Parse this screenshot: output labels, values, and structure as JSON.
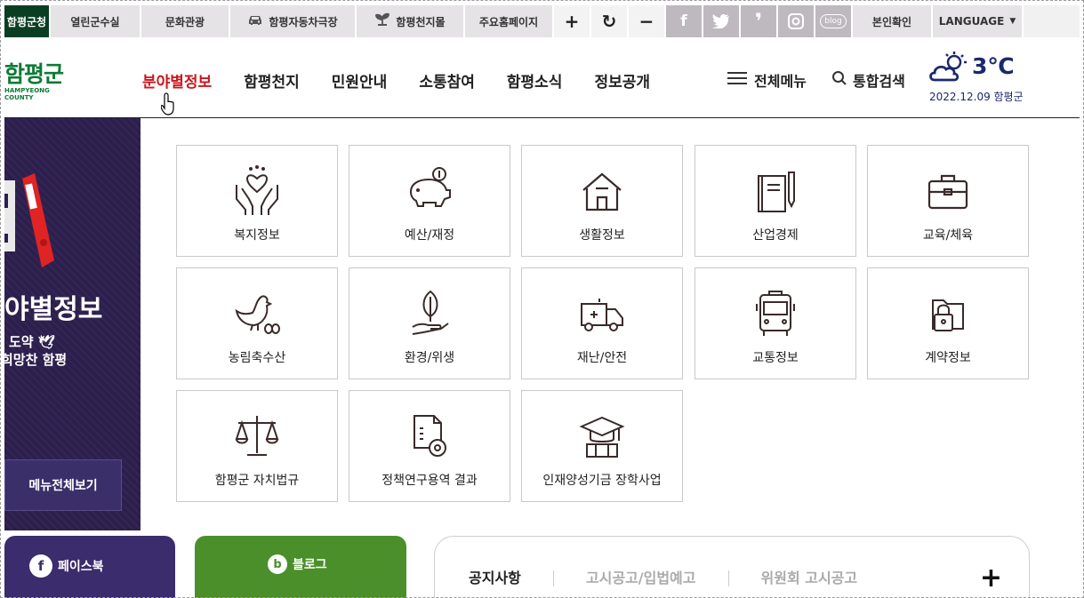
{
  "topbar": {
    "home": "함평군청",
    "items": [
      "열린군수실",
      "문화관광",
      "함평자동차극장",
      "함평천지몰",
      "주요홈페이지"
    ],
    "controls": [
      "+",
      "↻",
      "−"
    ],
    "sns": [
      "f",
      "🐦",
      "❜",
      "◎",
      "blog"
    ],
    "verify": "본인확인",
    "language": "LANGUAGE"
  },
  "header": {
    "logo_name": "함평군",
    "logo_sub": "HAMPYEONG COUNTY",
    "gnb": [
      "분야별정보",
      "함평천지",
      "민원안내",
      "소통참여",
      "함평소식",
      "정보공개"
    ],
    "all_menu": "전체메뉴",
    "search": "통합검색",
    "weather_temp": "3℃",
    "weather_date": "2022.12.09  함평군"
  },
  "left_panel": {
    "title": "야별정보",
    "subtitle_line1": "도약",
    "subtitle_line2": "희망찬 함평",
    "all_menu_button": "메뉴전체보기"
  },
  "cards": [
    {
      "label": "복지정보",
      "icon": "hands-heart-icon"
    },
    {
      "label": "예산/재정",
      "icon": "piggy-bank-icon"
    },
    {
      "label": "생활정보",
      "icon": "house-icon"
    },
    {
      "label": "산업경제",
      "icon": "book-pen-icon"
    },
    {
      "label": "교육/체육",
      "icon": "briefcase-icon"
    },
    {
      "label": "농림축수산",
      "icon": "chicken-icon"
    },
    {
      "label": "환경/위생",
      "icon": "leaf-hand-icon"
    },
    {
      "label": "재난/안전",
      "icon": "ambulance-icon"
    },
    {
      "label": "교통정보",
      "icon": "bus-icon"
    },
    {
      "label": "계약정보",
      "icon": "locked-folder-icon"
    },
    {
      "label": "함평군 자치법규",
      "icon": "scales-icon"
    },
    {
      "label": "정책연구용역 결과",
      "icon": "document-gear-icon"
    },
    {
      "label": "인재양성기금 장학사업",
      "icon": "graduation-cap-icon"
    }
  ],
  "bottom": {
    "facebook": "페이스북",
    "blog": "블로그",
    "notice_tabs": [
      "공지사항",
      "고시공고/입법예고",
      "위원회 고시공고"
    ],
    "more": "+"
  },
  "colors": {
    "accent_red": "#c8171e",
    "brand_green": "#0f7a36",
    "dark_purple": "#2d1f4d",
    "blog_green": "#4a8f2a"
  }
}
